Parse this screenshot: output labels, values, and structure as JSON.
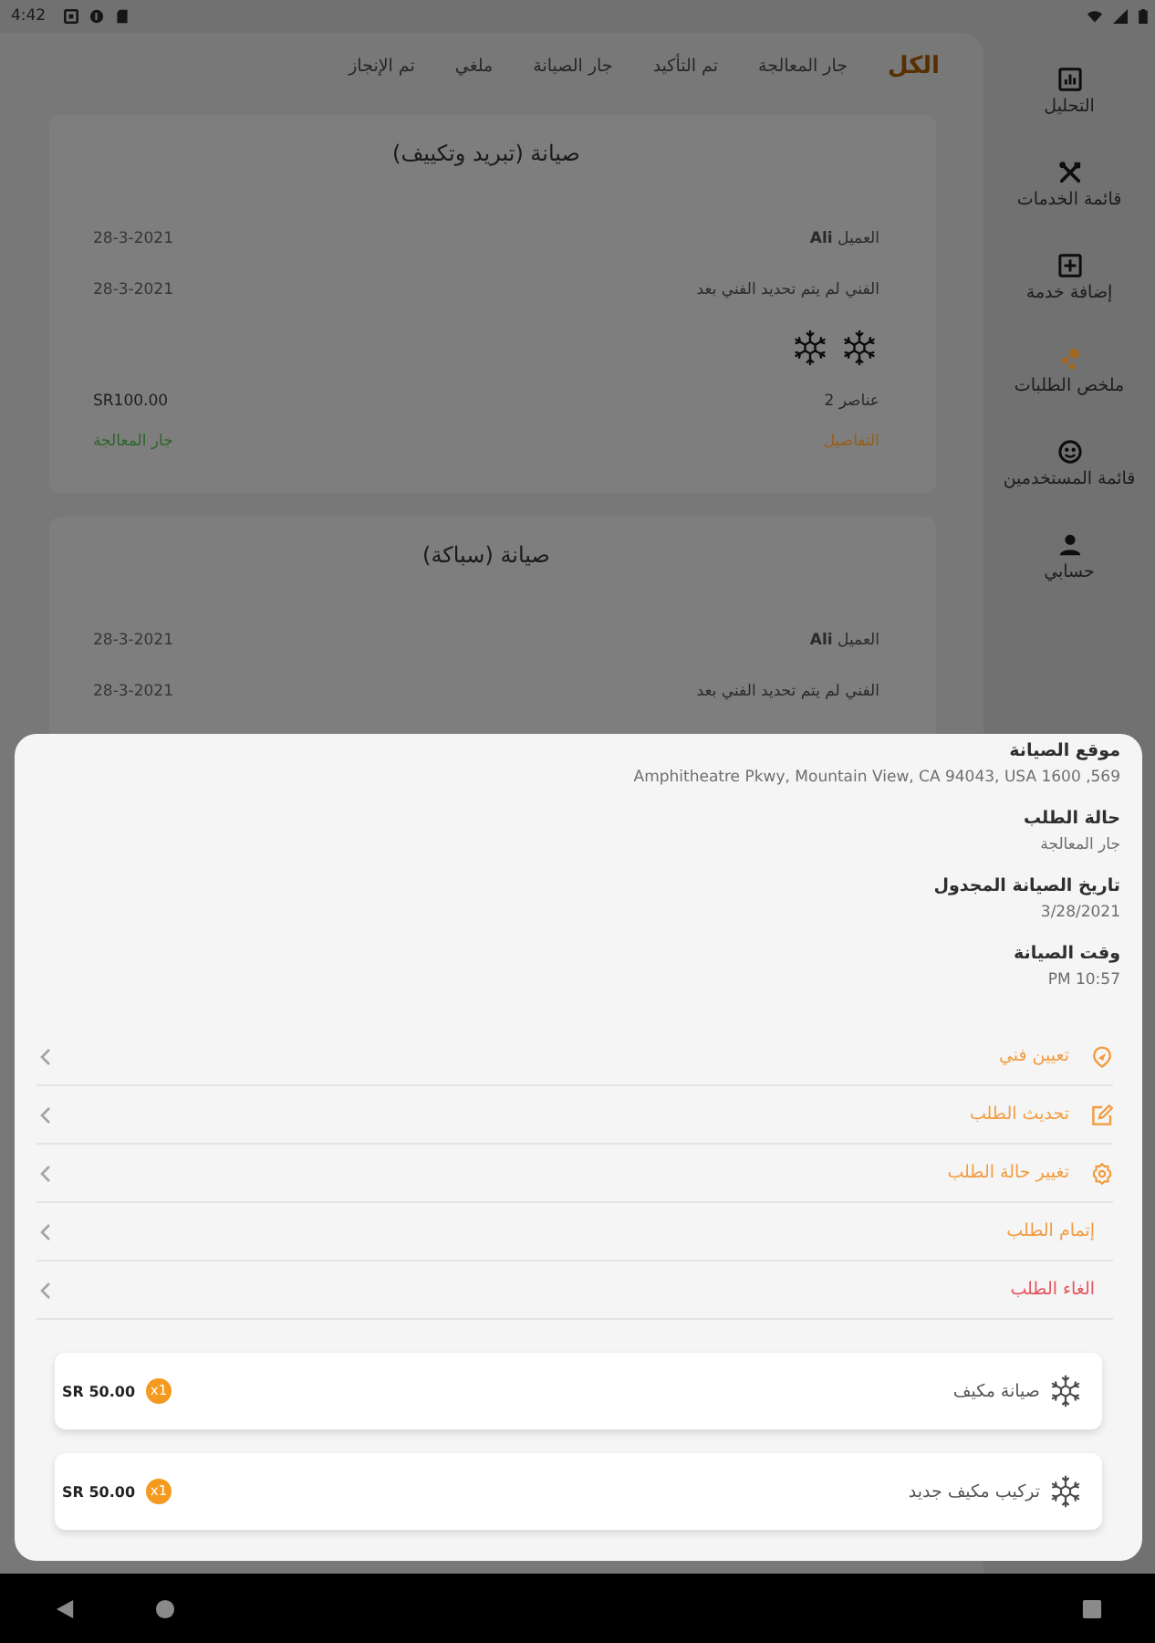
{
  "status_bar": {
    "time": "4:42"
  },
  "sidebar": {
    "items": [
      {
        "label": "التحليل",
        "selected": false
      },
      {
        "label": "قائمة الخدمات",
        "selected": false
      },
      {
        "label": "إضافة خدمة",
        "selected": false
      },
      {
        "label": "ملخص الطلبات",
        "selected": true
      },
      {
        "label": "قائمة المستخدمين",
        "selected": false
      },
      {
        "label": "حسابي",
        "selected": false
      }
    ]
  },
  "tabs": [
    {
      "label": "الكل",
      "selected": true
    },
    {
      "label": "جار المعالجة",
      "selected": false
    },
    {
      "label": "تم التأكيد",
      "selected": false
    },
    {
      "label": "جار الصيانة",
      "selected": false
    },
    {
      "label": "ملغي",
      "selected": false
    },
    {
      "label": "تم الإنجاز",
      "selected": false
    }
  ],
  "orders": [
    {
      "title": "صيانة (تبريد وتكييف)",
      "client": "العميل **Ali**",
      "client_date": "28-3-2021",
      "technician": "الفني لم يتم تحديد الفني بعد",
      "technician_date": "28-3-2021",
      "footer": {
        "count": "2 عناصر",
        "price": "SR100.00",
        "details_link": "التفاصيل",
        "status": "جار المعالجة"
      }
    },
    {
      "title": "صيانة (سباكة)",
      "client": "العميل **Ali**",
      "client_date": "28-3-2021",
      "technician": "الفني لم يتم تحديد الفني بعد",
      "technician_date": "28-3-2021"
    }
  ],
  "sheet": {
    "fields": [
      {
        "label": "موقع الصيانة",
        "value": "Amphitheatre Pkwy, Mountain View, CA 94043, USA 1600 ,569"
      },
      {
        "label": "حالة الطلب",
        "value": "جار المعالجة"
      },
      {
        "label": "تاريخ الصيانة المجدول",
        "value": "3/28/2021"
      },
      {
        "label": "وقت الصيانة",
        "value": "PM 10:57"
      }
    ],
    "actions": [
      {
        "label": "تعيين فني",
        "kind": "icon",
        "color": "#f29c3f"
      },
      {
        "label": "تحديث الطلب",
        "kind": "icon",
        "color": "#f29c3f"
      },
      {
        "label": "تغيير حالة الطلب",
        "kind": "icon",
        "color": "#f29c3f"
      },
      {
        "label": "إتمام الطلب",
        "kind": "text",
        "color": "#f29c3f"
      },
      {
        "label": "الغاء الطلب",
        "kind": "text",
        "color": "#e5535d"
      }
    ],
    "services": [
      {
        "name": "صيانة مكيف",
        "quantity": "x1",
        "price": "SR 50.00"
      },
      {
        "name": "تركيب مكيف جديد",
        "quantity": "x1",
        "price": "SR 50.00"
      }
    ]
  }
}
